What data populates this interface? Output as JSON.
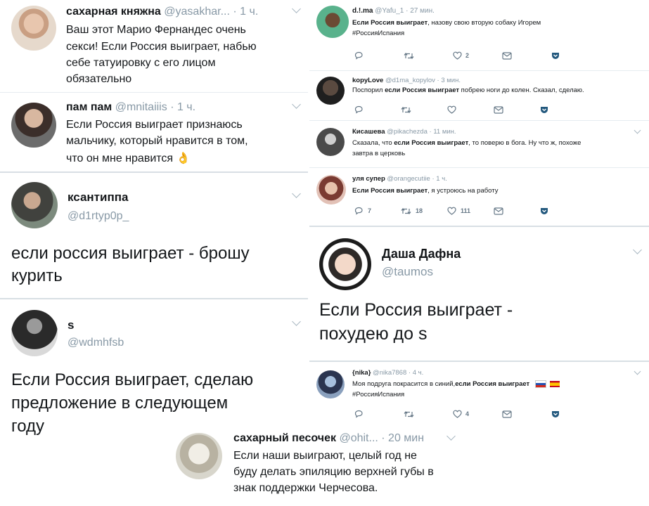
{
  "tweets": [
    {
      "id": "t1",
      "name": "сахарная княжна",
      "handle": "@yasakhar...",
      "time": "· 1 ч.",
      "lines": [
        "Ваш этот Марио Фернандес очень",
        "секси! Если Россия выиграет, набью",
        "себе татуировку с его лицом",
        "обязательно"
      ]
    },
    {
      "id": "t2",
      "name": "пам пам",
      "handle": "@mnitaiiis",
      "time": "· 1 ч.",
      "lines": [
        "Если Россия выиграет признаюсь",
        "мальчику, который нравится в том,",
        "что он мне нравится"
      ],
      "emoji": "👌"
    },
    {
      "id": "t3",
      "name": "ксантиппа",
      "handle": "@d1rtyp0p_",
      "lines": [
        "если россия выиграет - брошу",
        "курить"
      ]
    },
    {
      "id": "t4",
      "name": "s",
      "handle": "@wdmhfsb",
      "lines": [
        "Если Россия выиграет, сделаю",
        "предложение в следующем",
        "году"
      ]
    },
    {
      "id": "t5",
      "name": "d.!.ma",
      "handle": "@Yafu_1",
      "time": "· 27 мин.",
      "line1_bold": "Если Россия выиграет",
      "line1_rest": ", назову свою вторую собаку Игорем",
      "line2": "#РоссияИспания",
      "counts": {
        "reply": "",
        "retweet": "",
        "like": "2"
      }
    },
    {
      "id": "t6",
      "name": "kopyLove",
      "handle": "@d1ma_kopylov",
      "time": "· 3 мин.",
      "pre": "Поспорил ",
      "bold": "если Россия выиграет",
      "rest": " побрею ноги до колен. Сказал, сделаю."
    },
    {
      "id": "t7",
      "name": "Кисашева",
      "handle": "@pikachezda",
      "time": "· 11 мин.",
      "pre": "Сказала, что ",
      "bold": "если Россия выиграет",
      "rest": ", то поверю в бога. Ну что ж, похоже",
      "line2": "завтра в церковь"
    },
    {
      "id": "t8",
      "name": "уля супер",
      "handle": "@orangecutiie",
      "time": "· 1 ч.",
      "bold": "Если Россия выиграет",
      "rest": ", я устроюсь на работу",
      "counts": {
        "reply": "7",
        "retweet": "18",
        "like": "111"
      }
    },
    {
      "id": "t9",
      "name": "Даша Дафна",
      "handle": "@taumos",
      "lines": [
        "Если Россия выиграет -",
        "похудею до s"
      ]
    },
    {
      "id": "t10",
      "name": "{nika}",
      "handle": "@nika7868",
      "time": "· 4 ч.",
      "pre": "Моя подруга покрасится в синий, ",
      "bold": "если Россия выиграет",
      "line2": "#РоссияИспания",
      "counts": {
        "reply": "",
        "retweet": "",
        "like": "4"
      }
    },
    {
      "id": "t11",
      "name": "сахарный песочек",
      "handle": "@ohit...",
      "time": "· 20 мин",
      "lines": [
        "Если наши выиграют, целый год не",
        "буду делать эпиляцию верхней губы в",
        "знак поддержки Черчесова."
      ]
    }
  ],
  "colors": {
    "text": "#14171a",
    "muted": "#8899a6",
    "pocket": "#22587d"
  }
}
